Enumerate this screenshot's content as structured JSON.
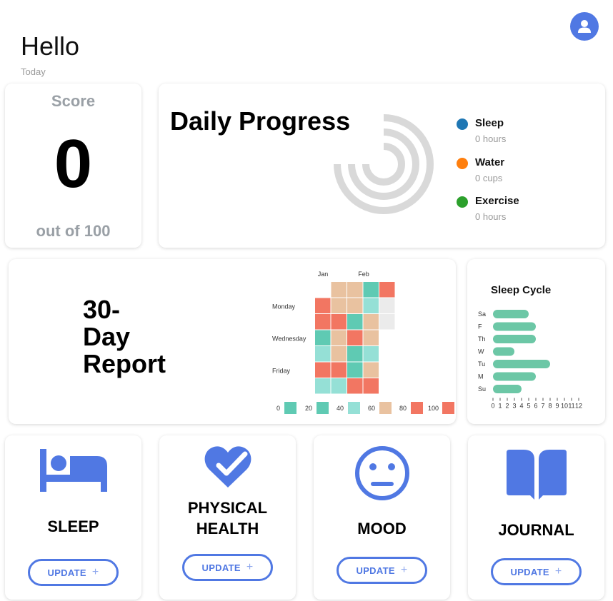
{
  "header": {
    "greeting": "Hello",
    "date_label": "Today",
    "avatar_icon": "user-icon"
  },
  "score": {
    "title": "Score",
    "value": "0",
    "subtitle": "out of 100"
  },
  "daily_progress": {
    "title": "Daily Progress",
    "ring_track_color": "#d9d9d9",
    "items": [
      {
        "label": "Sleep",
        "value": "0 hours",
        "color": "#1f77b4"
      },
      {
        "label": "Water",
        "value": "0 cups",
        "color": "#ff7f0e"
      },
      {
        "label": "Exercise",
        "value": "0 hours",
        "color": "#2ca02c"
      }
    ]
  },
  "report": {
    "title_lines": [
      "30-",
      "Day",
      "Report"
    ],
    "heatmap": {
      "month_labels": [
        "Jan",
        "Feb"
      ],
      "day_labels": [
        "Monday",
        "Wednesday",
        "Friday"
      ],
      "legend_values": [
        "0",
        "20",
        "40",
        "60",
        "80",
        "100"
      ],
      "colors": [
        "#5fcab3",
        "#5fcab3",
        "#95e0d6",
        "#e9c2a0",
        "#f27662",
        "#f27662"
      ],
      "empty_color": "#ebebeb",
      "weeks": [
        [
          null,
          4,
          4,
          0,
          2,
          4,
          2
        ],
        [
          3,
          3,
          4,
          3,
          3,
          4,
          2
        ],
        [
          3,
          3,
          0,
          4,
          0,
          1,
          4
        ],
        [
          1,
          2,
          3,
          3,
          2,
          3,
          4
        ],
        [
          4,
          "e",
          "e",
          null,
          null,
          null,
          null
        ]
      ]
    }
  },
  "sleep_cycle": {
    "title": "Sleep Cycle",
    "chart_data": {
      "type": "bar",
      "orientation": "horizontal",
      "categories": [
        "Sa",
        "F",
        "Th",
        "W",
        "Tu",
        "M",
        "Su"
      ],
      "values": [
        5,
        6,
        6,
        3,
        8,
        6,
        4
      ],
      "xlim": [
        0,
        12
      ],
      "x_ticks": [
        "0",
        "1",
        "2",
        "3",
        "4",
        "5",
        "6",
        "7",
        "8",
        "9",
        "10",
        "11",
        "12"
      ],
      "color": "#6cc7a6"
    }
  },
  "actions": [
    {
      "label_lines": [
        "SLEEP"
      ],
      "icon": "bed-icon",
      "button": "UPDATE",
      "button_icon": "plus-icon"
    },
    {
      "label_lines": [
        "PHYSICAL",
        "HEALTH"
      ],
      "icon": "heart-check-icon",
      "button": "UPDATE",
      "button_icon": "plus-icon"
    },
    {
      "label_lines": [
        "MOOD"
      ],
      "icon": "neutral-face-icon",
      "button": "UPDATE",
      "button_icon": "plus-icon"
    },
    {
      "label_lines": [
        "JOURNAL"
      ],
      "icon": "book-icon",
      "button": "UPDATE",
      "button_icon": "plus-icon"
    }
  ],
  "accent_color": "#5078e3"
}
